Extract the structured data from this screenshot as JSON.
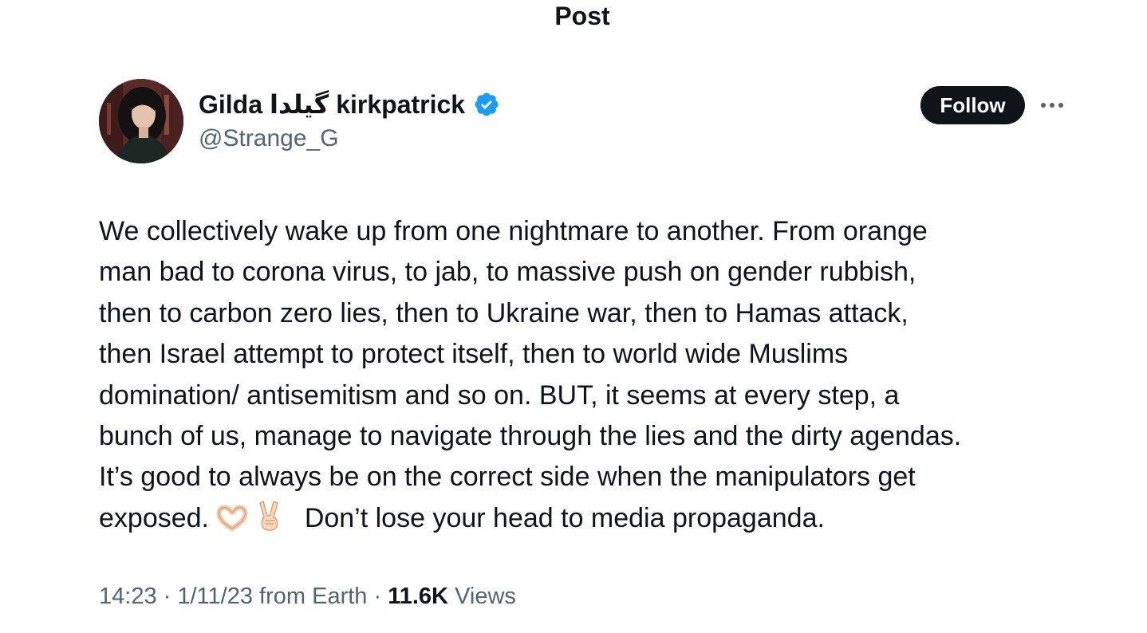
{
  "header": {
    "title": "Post"
  },
  "author": {
    "name_part1": "Gilda",
    "name_persian": "گیلدا",
    "name_part2": "kirkpatrick",
    "handle": "@Strange_G",
    "verified_color": "#1d9bf0"
  },
  "actions": {
    "follow_label": "Follow",
    "more_icon": "more-horizontal-icon"
  },
  "post": {
    "lines": [
      "We collectively wake up from one nightmare to another. From orange",
      "man bad to corona virus, to jab, to massive push on gender rubbish,",
      "then to carbon zero lies, then to Ukraine war, then to Hamas attack,",
      "then Israel attempt to protect itself, then to world wide Muslims",
      "domination/ antisemitism and so on. BUT, it seems at every step, a",
      "bunch of us, manage to navigate through the lies and the dirty agendas.",
      "It’s good to always be on the correct side when the manipulators get"
    ],
    "last_line_start": "exposed.",
    "last_line_end": "Don’t lose your head to media propaganda.",
    "emojis": [
      "heart-hands-emoji",
      "victory-hand-emoji"
    ]
  },
  "meta": {
    "time": "14:23",
    "sep1": "·",
    "date": "1/11/23",
    "source": "from Earth",
    "sep2": "·",
    "views_count": "11.6K",
    "views_label": "Views"
  }
}
